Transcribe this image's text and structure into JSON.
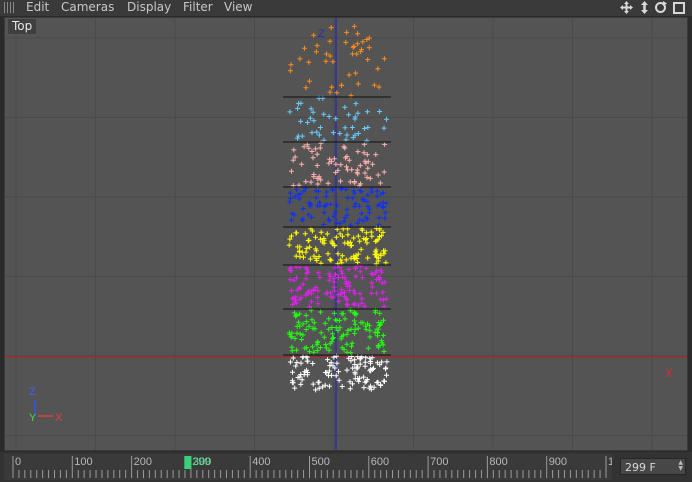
{
  "menu": {
    "items": [
      "Edit",
      "Cameras",
      "Display",
      "Filter",
      "View"
    ]
  },
  "toolbar": {
    "icons": [
      "move-view-icon",
      "zoom-view-icon",
      "rotate-view-icon",
      "maximize-view-icon"
    ]
  },
  "viewport": {
    "label": "Top",
    "axis_z": "Z",
    "axis_x": "X",
    "gizmo": {
      "z": "Z",
      "y": "Y",
      "x": "X"
    },
    "colors": {
      "background": "#545454",
      "grid": "#5f5f5f",
      "grid_major": "#4a4a4a",
      "x_axis": "#c02020",
      "z_axis": "#1c1cd0"
    },
    "particle_bands": [
      {
        "color": "#ff8c1a",
        "name": "orange"
      },
      {
        "color": "#66ccff",
        "name": "light-blue"
      },
      {
        "color": "#ffb0b0",
        "name": "pink"
      },
      {
        "color": "#0a30ff",
        "name": "blue"
      },
      {
        "color": "#ffff00",
        "name": "yellow"
      },
      {
        "color": "#e020f0",
        "name": "magenta"
      },
      {
        "color": "#22ff11",
        "name": "green"
      },
      {
        "color": "#ffffff",
        "name": "white"
      }
    ]
  },
  "timeline": {
    "ticks": [
      "0",
      "100",
      "200",
      "300",
      "400",
      "500",
      "600",
      "700",
      "800",
      "900",
      "100"
    ],
    "current_frame_label": "299",
    "current_frame": 299,
    "max_frame": 1000,
    "frame_field": "299 F"
  }
}
